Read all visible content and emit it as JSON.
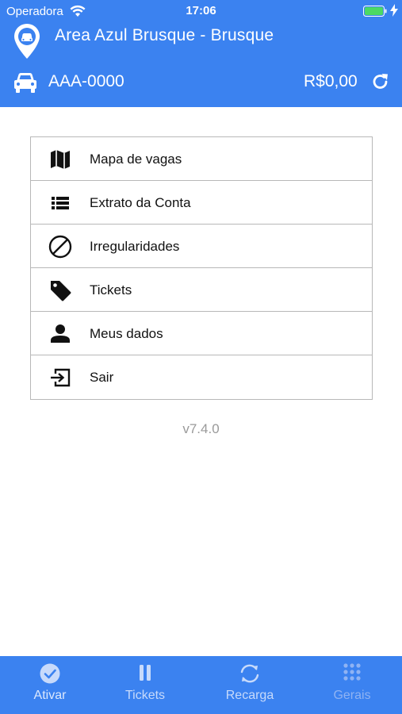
{
  "status_bar": {
    "carrier": "Operadora",
    "time": "17:06"
  },
  "header": {
    "title": "Area Azul Brusque - Brusque",
    "plate": "AAA-0000",
    "balance": "R$0,00"
  },
  "menu": {
    "items": [
      {
        "label": "Mapa de vagas",
        "icon": "map-icon"
      },
      {
        "label": "Extrato da Conta",
        "icon": "list-icon"
      },
      {
        "label": "Irregularidades",
        "icon": "prohibited-icon"
      },
      {
        "label": "Tickets",
        "icon": "tag-icon"
      },
      {
        "label": "Meus dados",
        "icon": "person-icon"
      },
      {
        "label": "Sair",
        "icon": "exit-icon"
      }
    ]
  },
  "version": "v7.4.0",
  "tabbar": {
    "tabs": [
      {
        "label": "Ativar",
        "icon": "check-circle-icon"
      },
      {
        "label": "Tickets",
        "icon": "pause-icon"
      },
      {
        "label": "Recarga",
        "icon": "refresh-icon"
      },
      {
        "label": "Gerais",
        "icon": "grid-icon"
      }
    ]
  },
  "colors": {
    "primary": "#3b82f0",
    "border": "#b8b8b8",
    "version_text": "#9a9a9a"
  }
}
